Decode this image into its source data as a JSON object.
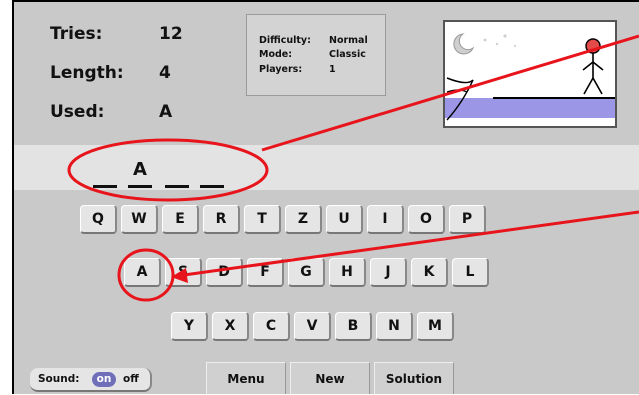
{
  "stats": {
    "tries_label": "Tries:",
    "tries_value": "12",
    "length_label": "Length:",
    "length_value": "4",
    "used_label": "Used:",
    "used_value": "A"
  },
  "settings": {
    "difficulty_label": "Difficulty:",
    "difficulty_value": "Normal",
    "mode_label": "Mode:",
    "mode_value": "Classic",
    "players_label": "Players:",
    "players_value": "1"
  },
  "word": {
    "letters": [
      "",
      "A",
      "",
      ""
    ]
  },
  "keyboard": {
    "row1": [
      "Q",
      "W",
      "E",
      "R",
      "T",
      "Z",
      "U",
      "I",
      "O",
      "P"
    ],
    "row2": [
      "A",
      "S",
      "D",
      "F",
      "G",
      "H",
      "J",
      "K",
      "L"
    ],
    "row3": [
      "Y",
      "X",
      "C",
      "V",
      "B",
      "N",
      "M"
    ]
  },
  "sound": {
    "label": "Sound:",
    "on": "on",
    "off": "off"
  },
  "buttons": {
    "menu": "Menu",
    "new": "New",
    "solution": "Solution"
  },
  "colors": {
    "annotation": "#e8141b",
    "selected_toggle": "#6e6fb8",
    "water": "#9b97e6"
  }
}
